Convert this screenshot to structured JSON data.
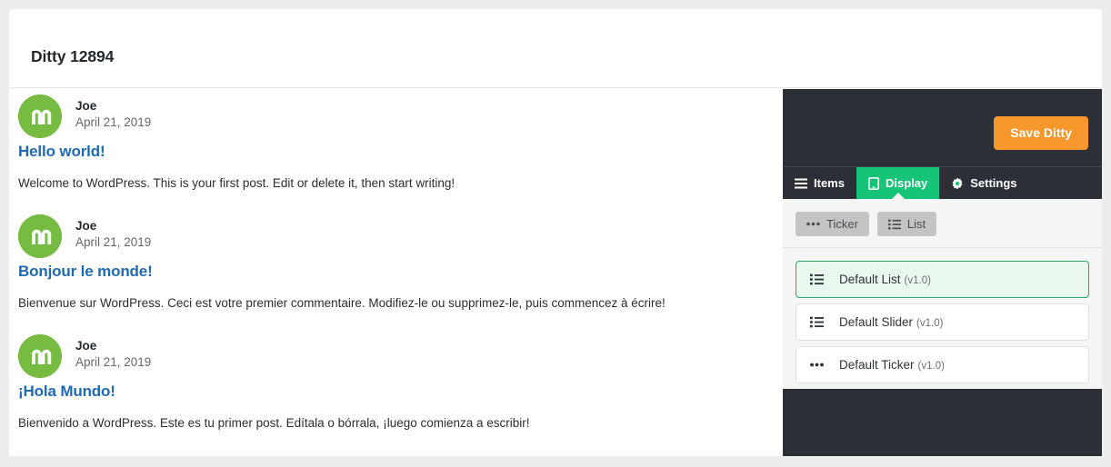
{
  "header": {
    "title": "Ditty 12894"
  },
  "preview": {
    "posts": [
      {
        "author": "Joe",
        "date": "April 21, 2019",
        "title": "Hello world!",
        "excerpt": "Welcome to WordPress. This is your first post. Edit or delete it, then start writing!",
        "avatar_icon": "metronet-m-avatar-icon"
      },
      {
        "author": "Joe",
        "date": "April 21, 2019",
        "title": "Bonjour le monde!",
        "excerpt": "Bienvenue sur WordPress. Ceci est votre premier commentaire. Modifiez-le ou supprimez-le, puis commencez à écrire!",
        "avatar_icon": "metronet-m-avatar-icon"
      },
      {
        "author": "Joe",
        "date": "April 21, 2019",
        "title": "¡Hola Mundo!",
        "excerpt": "Bienvenido a WordPress. Este es tu primer post. Edítala o bórrala, ¡luego comienza a escribir!",
        "avatar_icon": "metronet-m-avatar-icon"
      }
    ]
  },
  "editor": {
    "save_button_label": "Save Ditty",
    "tabs": [
      {
        "label": "Items",
        "icon": "hamburger-icon",
        "active": false
      },
      {
        "label": "Display",
        "icon": "tablet-icon",
        "active": true
      },
      {
        "label": "Settings",
        "icon": "gear-icon",
        "active": false
      }
    ],
    "filters": [
      {
        "label": "Ticker",
        "icon": "dots-icon"
      },
      {
        "label": "List",
        "icon": "list-icon"
      }
    ],
    "templates": [
      {
        "name": "Default List",
        "version": "(v1.0)",
        "icon": "list-icon",
        "selected": true
      },
      {
        "name": "Default Slider",
        "version": "(v1.0)",
        "icon": "list-icon",
        "selected": false
      },
      {
        "name": "Default Ticker",
        "version": "(v1.0)",
        "icon": "dots-icon",
        "selected": false
      }
    ]
  },
  "colors": {
    "accent_green": "#15c477",
    "selected_green_border": "#2aa86a",
    "selected_green_fill": "#eaf7ef",
    "save_orange": "#f8972c",
    "dark_panel": "#2c3036",
    "link_blue": "#1f6ab0",
    "avatar_green": "#76bc43"
  }
}
